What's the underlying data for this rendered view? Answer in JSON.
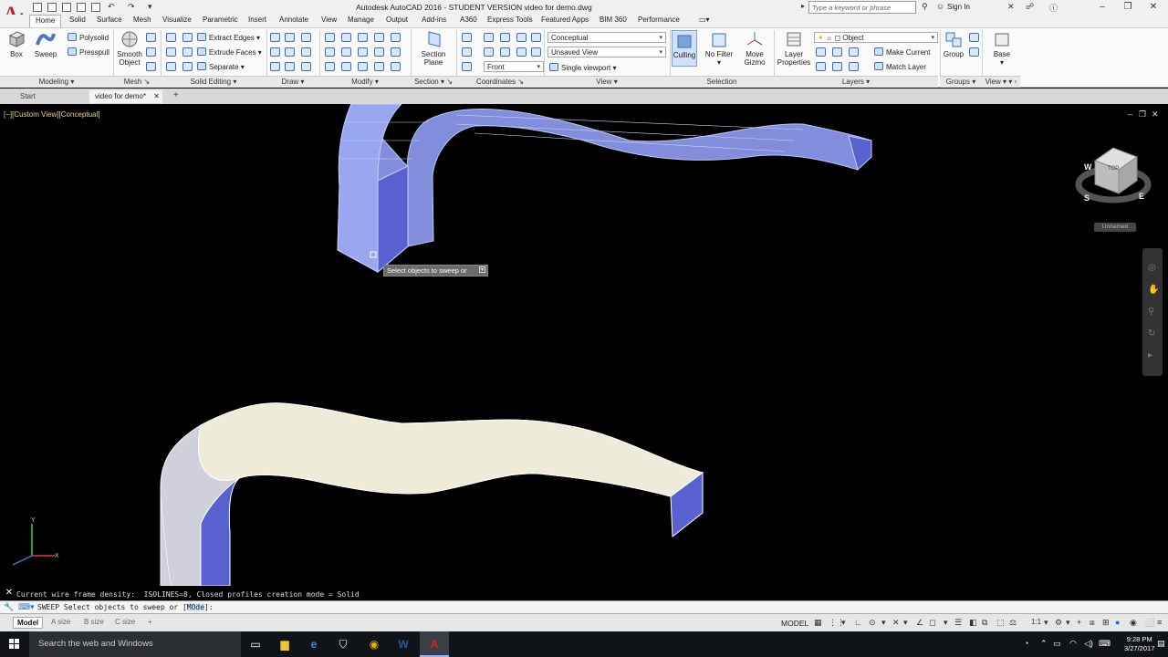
{
  "window": {
    "title": "Autodesk AutoCAD 2016 - STUDENT VERSION    video for demo.dwg",
    "search_placeholder": "Type a keyword or phrase",
    "sign_in": "Sign In"
  },
  "ribbon_tabs": [
    "Home",
    "Solid",
    "Surface",
    "Mesh",
    "Visualize",
    "Parametric",
    "Insert",
    "Annotate",
    "View",
    "Manage",
    "Output",
    "Add-ins",
    "A360",
    "Express Tools",
    "Featured Apps",
    "BIM 360",
    "Performance"
  ],
  "ribbon": {
    "modeling": {
      "label": "Modeling",
      "box": "Box",
      "sweep": "Sweep",
      "polysolid": "Polysolid",
      "presspull": "Presspull"
    },
    "mesh": {
      "label": "Mesh",
      "smooth_object_1": "Smooth",
      "smooth_object_2": "Object"
    },
    "solid_editing": {
      "label": "Solid Editing",
      "extract_edges": "Extract Edges",
      "extrude_faces": "Extrude Faces",
      "separate": "Separate"
    },
    "draw": {
      "label": "Draw"
    },
    "modify": {
      "label": "Modify"
    },
    "section": {
      "label": "Section",
      "section_plane_1": "Section",
      "section_plane_2": "Plane"
    },
    "coordinates": {
      "label": "Coordinates",
      "front": "Front"
    },
    "view": {
      "label": "View",
      "visual_style": "Conceptual",
      "named_view": "Unsaved View",
      "viewport": "Single viewport"
    },
    "selection": {
      "label": "Selection",
      "culling": "Culling",
      "no_filter": "No Filter",
      "move_gizmo_1": "Move",
      "move_gizmo_2": "Gizmo"
    },
    "layers": {
      "label": "Layers",
      "layer_props_1": "Layer",
      "layer_props_2": "Properties",
      "current_layer": "Object",
      "make_current": "Make Current",
      "match_layer": "Match Layer"
    },
    "groups": {
      "label": "Groups",
      "group": "Group"
    },
    "view2": {
      "label": "View",
      "base": "Base"
    }
  },
  "file_tabs": [
    "Start",
    "video for demo*"
  ],
  "viewport": {
    "label": "[−][Custom View][Conceptual]",
    "tooltip": "Select objects to sweep or",
    "viewcube_top": "TOP",
    "view_name": "Unnamed",
    "compass": {
      "n": "N",
      "w": "W",
      "s": "S",
      "e": "E"
    }
  },
  "command": {
    "history": "Current wire frame density:  ISOLINES=8, Closed profiles creation mode = Solid",
    "prompt": "SWEEP Select objects to sweep or [",
    "mode_option": "MOde",
    "prompt_end": "]:"
  },
  "layout_tabs": [
    "Model",
    "A size",
    "B size",
    "C size"
  ],
  "status": {
    "space": "MODEL",
    "scale": "1:1"
  },
  "taskbar": {
    "search": "Search the web and Windows",
    "time": "9:28 PM",
    "date": "3/27/2017"
  },
  "colors": {
    "viewport_bg": "#000000",
    "solid_top": "#eeecd8",
    "solid_side": "#cfd0da",
    "solid_end": "#5961d0",
    "ghost_solid": "#8a96e8",
    "tooltip_bg": "#6b6b6b"
  }
}
